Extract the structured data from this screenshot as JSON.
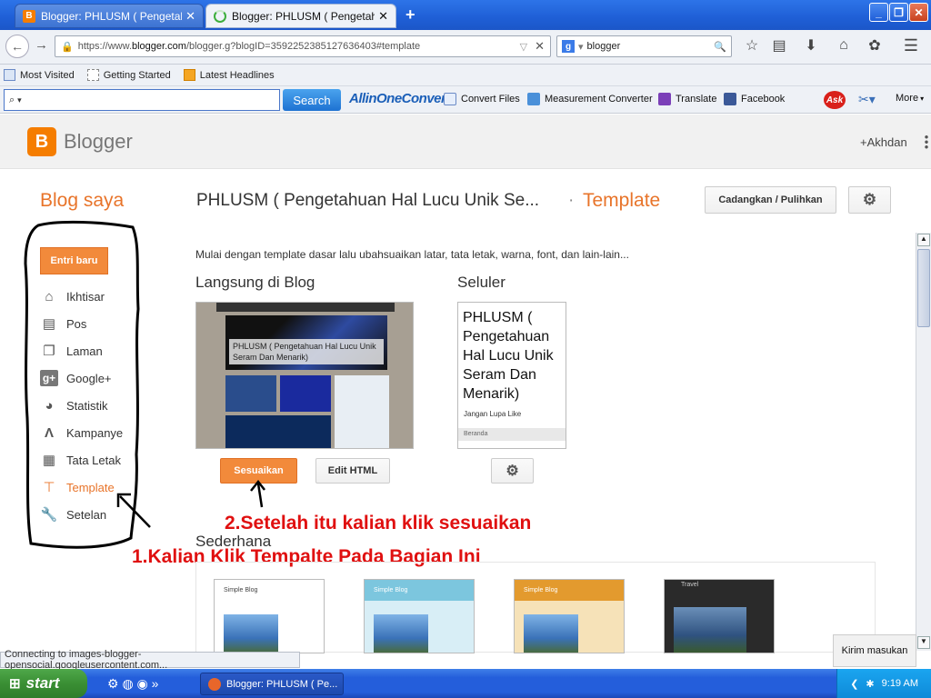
{
  "browser": {
    "tabs": [
      {
        "title": "Blogger: PHLUSM ( Pengetahuan ..."
      },
      {
        "title": "Blogger: PHLUSM ( Pengetahuan ..."
      }
    ],
    "new_tab": "+",
    "url_prefix": "https://www.",
    "url_domain": "blogger.com",
    "url_rest": "/blogger.g?blogID=3592252385127636403#template",
    "search_value": "blogger"
  },
  "bookmarks": [
    "Most Visited",
    "Getting Started",
    "Latest Headlines"
  ],
  "toolbar": {
    "search_button": "Search",
    "allinone": "AllinOneConvert",
    "links": [
      "Convert Files",
      "Measurement Converter",
      "Translate",
      "Facebook"
    ],
    "more": "More"
  },
  "blogger": {
    "logo_text": "Blogger",
    "user": "+Akhdan",
    "blog_saya": "Blog saya",
    "blog_title": "PHLUSM ( Pengetahuan Hal Lucu Unik Se...",
    "separator": "·",
    "section_title": "Template",
    "backup_button": "Cadangkan / Pulihkan"
  },
  "sidebar": {
    "new_post": "Entri baru",
    "items": [
      {
        "label": "Ikhtisar",
        "icon": "home-icon"
      },
      {
        "label": "Pos",
        "icon": "posts-icon"
      },
      {
        "label": "Laman",
        "icon": "pages-icon"
      },
      {
        "label": "Google+",
        "icon": "google-plus-icon"
      },
      {
        "label": "Statistik",
        "icon": "stats-icon"
      },
      {
        "label": "Kampanye",
        "icon": "campaign-icon"
      },
      {
        "label": "Tata Letak",
        "icon": "layout-icon"
      },
      {
        "label": "Template",
        "icon": "template-icon"
      },
      {
        "label": "Setelan",
        "icon": "settings-wrench-icon"
      }
    ]
  },
  "main": {
    "intro": "Mulai dengan template dasar lalu ubahsuaikan latar, tata letak, warna, font, dan lain-lain...",
    "live_blog": "Langsung di Blog",
    "mobile": "Seluler",
    "blog_preview_title": "PHLUSM ( Pengetahuan Hal Lucu Unik Seram Dan Menarik)",
    "mobile_preview_title": "PHLUSM ( Pengetahuan Hal Lucu Unik Seram Dan Menarik)",
    "mobile_preview_sub": "Jangan Lupa Like",
    "mobile_preview_nav": "Beranda",
    "customize_button": "Sesuaikan",
    "edit_html_button": "Edit HTML",
    "simple_section": "Sederhana",
    "simple_thumbs": [
      "Simple Blog",
      "Simple Blog",
      "Simple Blog",
      "Travel"
    ]
  },
  "annotations": {
    "step2": "2.Setelah itu kalian klik sesuaikan",
    "step1": "1.Kalian Klik Tempalte Pada Bagian Ini"
  },
  "status_text": "Connecting to images-blogger-opensocial.googleusercontent.com...",
  "feedback_button": "Kirim masukan",
  "taskbar": {
    "start": "start",
    "item": "Blogger: PHLUSM ( Pe...",
    "time": "9:19 AM"
  },
  "colors": {
    "accent": "#e8742a",
    "annotation": "#e01010"
  }
}
